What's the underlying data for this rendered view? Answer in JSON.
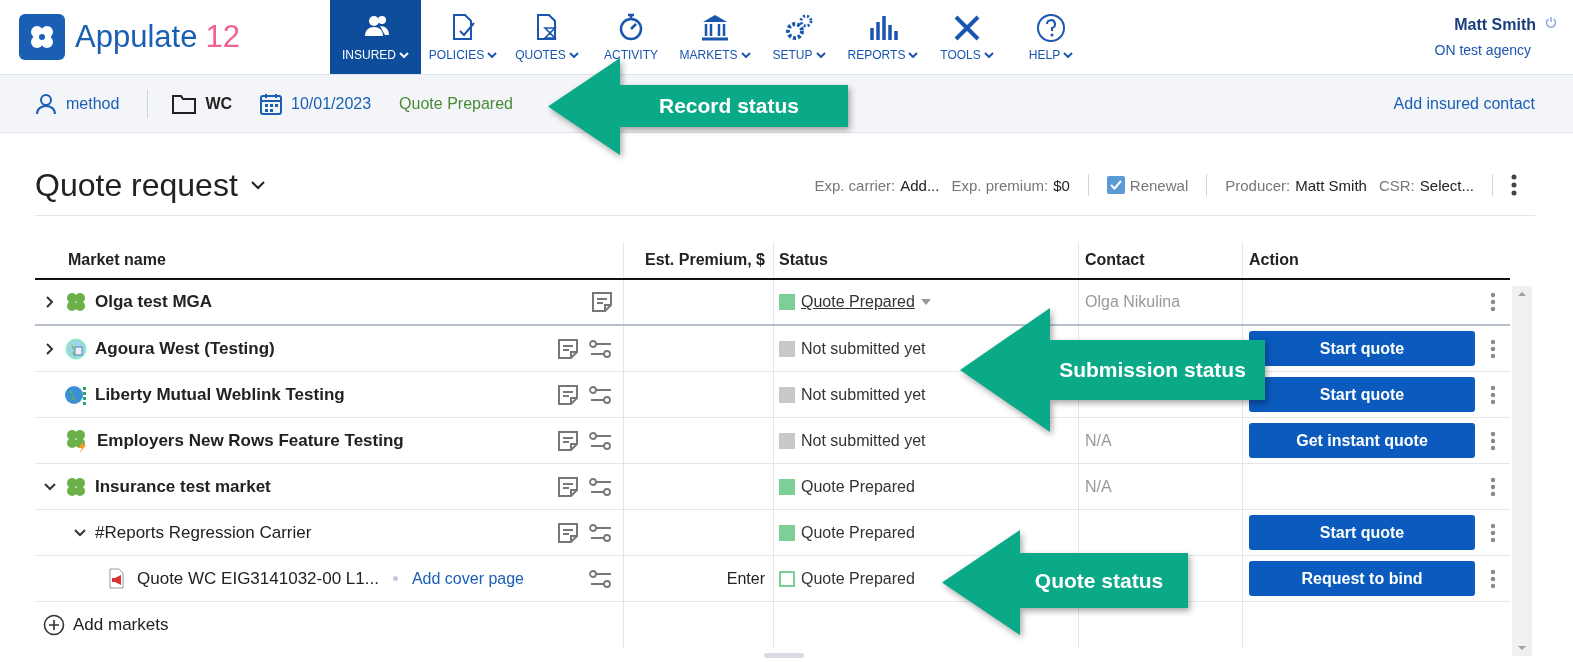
{
  "logo": {
    "name": "Appulate",
    "version": "12"
  },
  "nav": [
    {
      "label": "INSURED",
      "selected": true,
      "caret": true
    },
    {
      "label": "POLICIES",
      "selected": false,
      "caret": true
    },
    {
      "label": "QUOTES",
      "selected": false,
      "caret": true
    },
    {
      "label": "ACTIVITY",
      "selected": false,
      "caret": false
    },
    {
      "label": "MARKETS",
      "selected": false,
      "caret": true
    },
    {
      "label": "SETUP",
      "selected": false,
      "caret": true
    },
    {
      "label": "REPORTS",
      "selected": false,
      "caret": true
    },
    {
      "label": "TOOLS",
      "selected": false,
      "caret": true
    },
    {
      "label": "HELP",
      "selected": false,
      "caret": true
    }
  ],
  "user": {
    "name": "Matt Smith",
    "agency": "ON test agency"
  },
  "record": {
    "insured": "method",
    "line": "WC",
    "date": "10/01/2023",
    "status": "Quote Prepared",
    "link": "Add insured contact"
  },
  "title": "Quote request",
  "details": [
    {
      "label": "Exp. carrier:",
      "value": "Add..."
    },
    {
      "label": "Exp. premium:",
      "value": "$0"
    }
  ],
  "renewal": {
    "label": "Renewal",
    "checked": true
  },
  "people": [
    {
      "label": "Producer:",
      "value": "Matt Smith"
    },
    {
      "label": "CSR:",
      "value": "Select..."
    }
  ],
  "table": {
    "columns": [
      "Market name",
      "Est. Premium, $",
      "Status",
      "Contact",
      "Action"
    ],
    "rows": [
      {
        "kind": "market",
        "name": "Olga test MGA",
        "expanded": false,
        "notes": true,
        "settings": false,
        "status": {
          "text": "Quote Prepared",
          "color": "#7bcf97",
          "hollow": false,
          "dropdown": true
        },
        "contact": "Olga Nikulina"
      },
      {
        "kind": "market",
        "name": "Agoura West (Testing)",
        "expanded": false,
        "notes": true,
        "settings": true,
        "status": {
          "text": "Not submitted yet",
          "color": "#c8c8c8",
          "hollow": false,
          "dropdown": false
        },
        "action": "Start quote"
      },
      {
        "kind": "market",
        "name": "Liberty Mutual Weblink Testing",
        "notes": true,
        "settings": true,
        "status": {
          "text": "Not submitted yet",
          "color": "#c8c8c8",
          "hollow": false,
          "dropdown": false
        },
        "action": "Start quote"
      },
      {
        "kind": "market",
        "name": "Employers New Rows Feature Testing",
        "notes": true,
        "settings": true,
        "status": {
          "text": "Not submitted yet",
          "color": "#c8c8c8",
          "hollow": false,
          "dropdown": false
        },
        "contact": "N/A",
        "action": "Get instant quote"
      },
      {
        "kind": "market",
        "name": "Insurance test market",
        "expanded": true,
        "notes": true,
        "settings": true,
        "status": {
          "text": "Quote Prepared",
          "color": "#7bcf97",
          "hollow": false,
          "dropdown": false
        },
        "contact": "N/A",
        "children": [
          {
            "kind": "carrier",
            "name": "#Reports Regression Carrier",
            "expanded": true,
            "notes": true,
            "settings": true,
            "status": {
              "text": "Quote Prepared",
              "color": "#7bcf97",
              "hollow": false,
              "dropdown": false
            },
            "action": "Start quote",
            "children": [
              {
                "kind": "quote",
                "name": "Quote WC EIG3141032-00 L1...",
                "link": "Add cover page",
                "notes": false,
                "settings": true,
                "premium": "Enter",
                "status": {
                  "text": "Quote Prepared",
                  "color": "#7bcf97",
                  "hollow": true,
                  "dropdown": false
                },
                "action": "Request to bind"
              }
            ]
          }
        ]
      }
    ],
    "add": "Add markets"
  },
  "callouts": [
    "Record status",
    "Submission status",
    "Quote status"
  ]
}
